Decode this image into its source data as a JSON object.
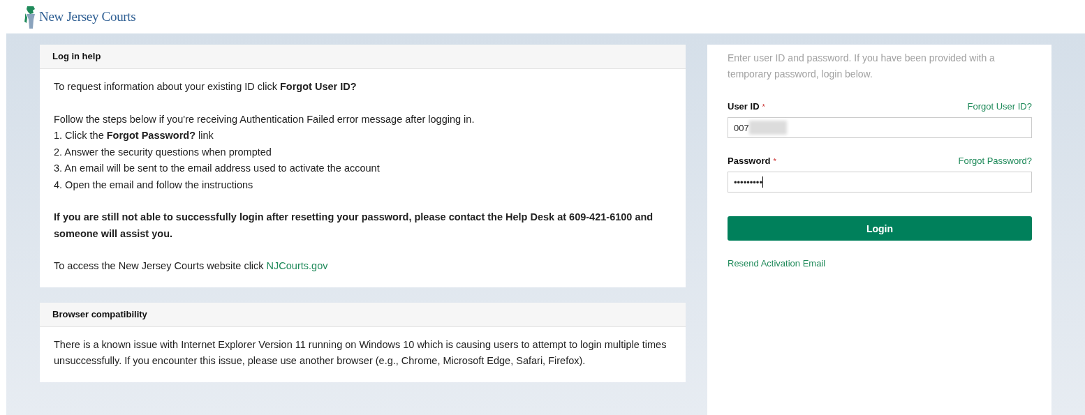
{
  "header": {
    "logo_text": "New Jersey Courts"
  },
  "help_panels": [
    {
      "title": "Log in help",
      "paragraphs": [
        {
          "kind": "text",
          "text": "To request information about your existing ID click **Forgot User ID?**"
        },
        {
          "kind": "list",
          "lines": [
            "Follow the steps below if you're receiving Authentication Failed error message after logging in.",
            "1. Click the **Forgot Password?** link",
            "2. Answer the security questions when prompted",
            "3. An email will be sent to the email address used to activate the account",
            "4. Open the email and follow the instructions"
          ]
        },
        {
          "kind": "bold",
          "text": "If you are still not able to successfully login after resetting your password, please contact the Help Desk at 609-421-6100 and someone will assist you."
        },
        {
          "kind": "link",
          "text": "To access the New Jersey Courts website click ",
          "link": "NJCourts.gov"
        }
      ]
    },
    {
      "title": "Browser compatibility",
      "paragraphs": [
        {
          "kind": "text",
          "text": "There is a known issue with Internet Explorer Version 11 running on Windows 10 which is causing users to attempt to login multiple times unsuccessfully. If you encounter this issue, please use another browser (e.g., Chrome, Microsoft Edge, Safari, Firefox)."
        }
      ]
    }
  ],
  "login": {
    "intro": "Enter user ID and password. If you have been provided with a temporary password, login below.",
    "fields": [
      {
        "label": "User ID",
        "required": "*",
        "link": "Forgot User ID?",
        "value": "007",
        "redacted": true,
        "caret": false
      },
      {
        "label": "Password",
        "required": "*",
        "link": "Forgot Password?",
        "value": "•••••••••",
        "redacted": false,
        "caret": true
      }
    ],
    "button": "Login",
    "resend_link": "Resend Activation Email"
  }
}
